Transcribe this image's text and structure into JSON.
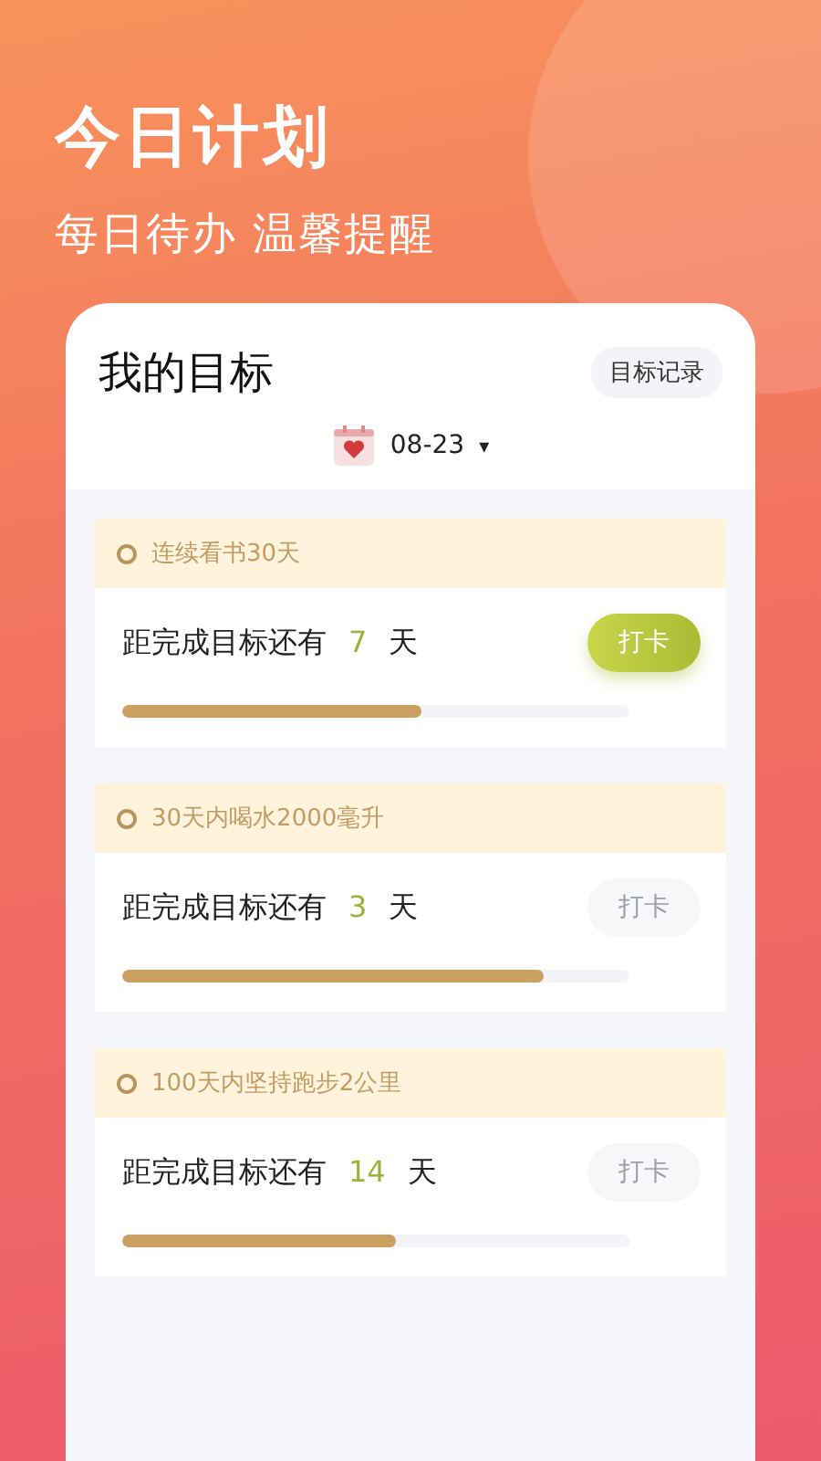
{
  "headline": "今日计划",
  "subtitle": "每日待办 温馨提醒",
  "panel": {
    "title": "我的目标",
    "records_button": "目标记录",
    "date": "08-23",
    "date_caret": "▾"
  },
  "goals": [
    {
      "name": "连续看书30天",
      "prefix": "距完成目标还有",
      "days": "7",
      "unit": "天",
      "button": "打卡",
      "disabled": false,
      "level": 0.59
    },
    {
      "name": "30天内喝水2000毫升",
      "prefix": "距完成目标还有",
      "days": "3",
      "unit": "天",
      "button": "打卡",
      "disabled": true,
      "level": 0.83
    },
    {
      "name": "100天内坚持跑步2公里",
      "prefix": "距完成目标还有",
      "days": "14",
      "unit": "天",
      "button": "打卡",
      "disabled": true,
      "level": 0.54
    }
  ]
}
